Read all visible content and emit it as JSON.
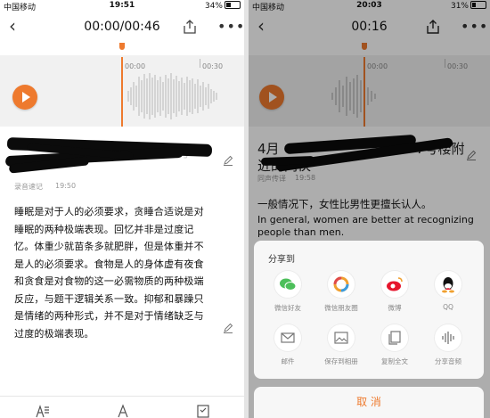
{
  "left": {
    "status": {
      "carrier": "中国移动",
      "time": "19:51",
      "battery": "34%",
      "battery_level": 0.34
    },
    "nav": {
      "title": "00:00/00:46"
    },
    "wave": {
      "tick1": "00:00",
      "tick2": "00:30"
    },
    "note": {
      "title_visible": "近的",
      "source": "录音速记",
      "time": "19:50"
    },
    "body_lines": [
      "睡眠是对于人的必须要求，贪睡合适说是对",
      "睡眠的两种极端表现。回忆并非是过度记",
      "忆。体重少就苗条多就肥胖，但是体重并不",
      "是人的必须要求。食物是人的身体虚有夜食",
      "和贪食是对食物的这一必需物质的两种极端",
      "反应，与题干逻辑关系一致。抑郁和暴躁只",
      "是情绪的两种形式，并不是对于情绪缺乏与",
      "过度的极端表现。"
    ]
  },
  "right": {
    "status": {
      "carrier": "中国移动",
      "time": "20:03",
      "battery": "31%",
      "battery_level": 0.31
    },
    "nav": {
      "title": "00:16"
    },
    "wave": {
      "tick1": "00:00",
      "tick2": "00:30"
    },
    "note": {
      "title_line1": "4月",
      "title_line1_end": "7号楼附",
      "title_line2": "近的同伙",
      "source": "同声传译",
      "time": "19:58"
    },
    "body_zh": "一般情况下，女性比男性更擅长认人。",
    "body_en1": "In general, women are better at recognizing",
    "body_en2": "people than men.",
    "share": {
      "title": "分享到",
      "items": [
        {
          "label": "微信好友",
          "icon": "wechat-icon",
          "color": "#4cbf5a"
        },
        {
          "label": "微信朋友圈",
          "icon": "moments-icon",
          "color": "#f0a030"
        },
        {
          "label": "微博",
          "icon": "weibo-icon",
          "color": "#e6162d"
        },
        {
          "label": "QQ",
          "icon": "qq-icon",
          "color": "#111111"
        },
        {
          "label": "邮件",
          "icon": "mail-icon",
          "color": "#888888"
        },
        {
          "label": "保存到相册",
          "icon": "album-icon",
          "color": "#888888"
        },
        {
          "label": "复制全文",
          "icon": "copy-icon",
          "color": "#888888"
        },
        {
          "label": "分享音频",
          "icon": "audio-wave-icon",
          "color": "#888888"
        }
      ],
      "cancel": "取 消"
    }
  },
  "colors": {
    "accent": "#ee7a2e"
  }
}
